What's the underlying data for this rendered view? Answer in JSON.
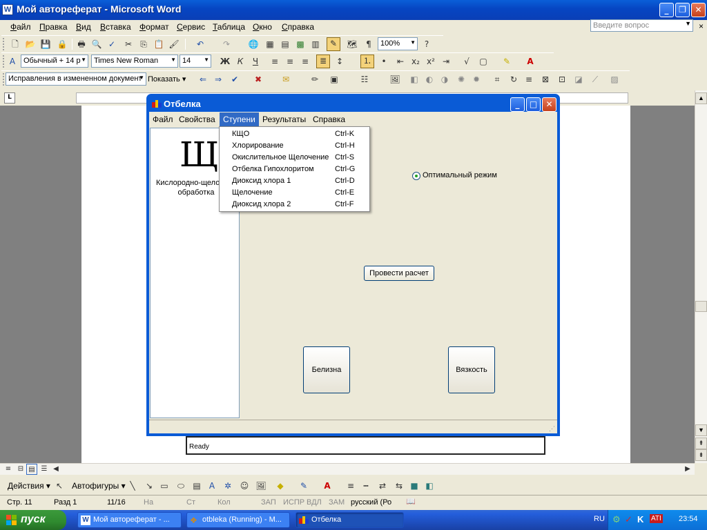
{
  "word": {
    "title": "Мой автореферат - Microsoft Word",
    "menu": [
      "Файл",
      "Правка",
      "Вид",
      "Вставка",
      "Формат",
      "Сервис",
      "Таблица",
      "Окно",
      "Справка"
    ],
    "help_placeholder": "Введите вопрос",
    "zoom": "100%",
    "style": "Обычный + 14 р",
    "font": "Times New Roman",
    "font_size": "14",
    "track_changes": "Исправления в измененном документ",
    "show_label": "Показать",
    "drawing": {
      "actions": "Действия",
      "autoshapes": "Автофигуры"
    },
    "status": [
      {
        "text": "Стр.  11",
        "dim": false
      },
      {
        "text": "Разд  1",
        "dim": false
      },
      {
        "text": "11/16",
        "dim": false
      },
      {
        "text": "На",
        "dim": true
      },
      {
        "text": "Ст",
        "dim": true
      },
      {
        "text": "Кол",
        "dim": true
      },
      {
        "text": "ЗАП",
        "dim": true
      },
      {
        "text": "ИСПР",
        "dim": true
      },
      {
        "text": "ВДЛ",
        "dim": true
      },
      {
        "text": "ЗАМ",
        "dim": true
      },
      {
        "text": "русский (Ро",
        "dim": false
      }
    ]
  },
  "dialog": {
    "title": "Отбелка",
    "menu": [
      "Файл",
      "Свойства",
      "Ступени",
      "Результаты",
      "Справка"
    ],
    "active_menu": "Ступени",
    "dropdown": [
      {
        "label": "КЩО",
        "shortcut": "Ctrl-K"
      },
      {
        "label": "Хлорирование",
        "shortcut": "Ctrl-H"
      },
      {
        "label": "Окислительное Щелочение",
        "shortcut": "Ctrl-S"
      },
      {
        "label": "Отбелка Гипохлоритом",
        "shortcut": "Ctrl-G"
      },
      {
        "label": "Диоксид хлора 1",
        "shortcut": "Ctrl-D"
      },
      {
        "label": "Щелочение",
        "shortcut": "Ctrl-E"
      },
      {
        "label": "Диоксид хлора 2",
        "shortcut": "Ctrl-F"
      }
    ],
    "panel_letter": "Щ",
    "panel_caption": "Кислородно-щелочная обработка",
    "radio_label": "Оптимальный режим",
    "calc_button": "Провести расчет",
    "button_whiteness": "Белизна",
    "button_viscosity": "Вязкость"
  },
  "ready_text": "Ready",
  "taskbar": {
    "start": "пуск",
    "tasks": [
      "Мой автореферат - ...",
      "otbleka (Running) - M...",
      "Отбелка"
    ],
    "lang": "RU",
    "clock": "23:54"
  },
  "colors": {
    "xp_blue": "#0a5bd6",
    "menu_highlight": "#316ac5",
    "start_green": "#2f8a2f"
  }
}
